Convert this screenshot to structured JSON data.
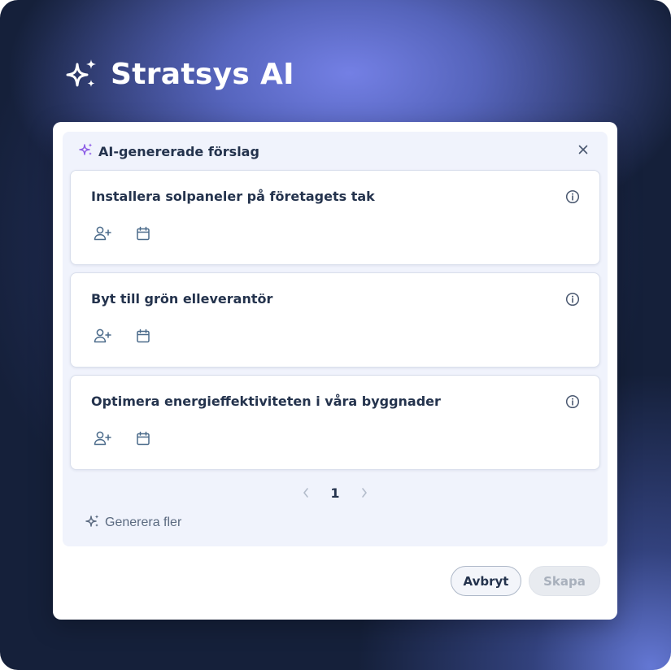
{
  "brand": {
    "icon": "sparkles-icon",
    "title": "Stratsys AI"
  },
  "panel": {
    "icon": "sparkles-icon",
    "title": "AI-genererade förslag",
    "close_icon": "close-icon"
  },
  "suggestions": [
    {
      "title": "Installera solpaneler på företagets tak"
    },
    {
      "title": "Byt till grön elleverantör"
    },
    {
      "title": "Optimera energieffektiviteten i våra byggnader"
    }
  ],
  "card_icons": [
    "info-icon",
    "add-user-icon",
    "calendar-icon"
  ],
  "pagination": {
    "current_page": "1",
    "prev_icon": "chevron-left-icon",
    "next_icon": "chevron-right-icon"
  },
  "generate_more": {
    "icon": "sparkles-icon",
    "label": "Generera fler"
  },
  "footer": {
    "cancel_label": "Avbryt",
    "create_label": "Skapa"
  },
  "colors": {
    "accent_purple": "#8c5ce6",
    "text_dark": "#24334d",
    "panel_bg": "#f0f3fc"
  }
}
